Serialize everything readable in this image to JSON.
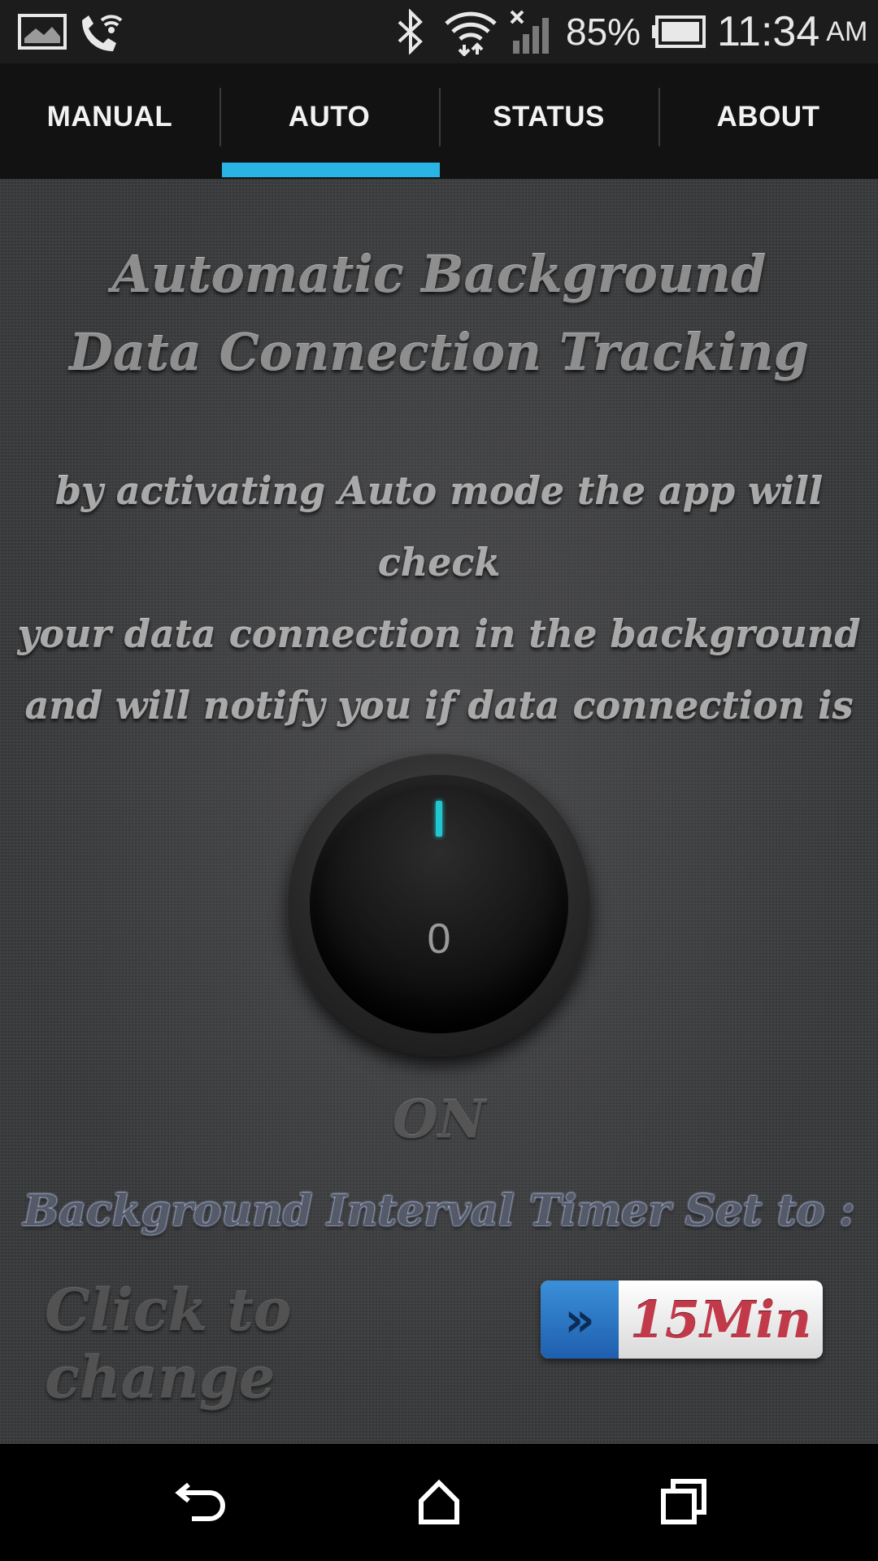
{
  "status_bar": {
    "battery_percent": "85%",
    "time": "11:34",
    "ampm": "AM",
    "icons": [
      "gallery-notification-icon",
      "wifi-calling-icon",
      "bluetooth-icon",
      "wifi-icon",
      "signal-icon",
      "battery-icon"
    ]
  },
  "tabs": [
    {
      "label": "MANUAL",
      "selected": false
    },
    {
      "label": "AUTO",
      "selected": true
    },
    {
      "label": "STATUS",
      "selected": false
    },
    {
      "label": "ABOUT",
      "selected": false
    }
  ],
  "colors": {
    "accent": "#2ab4e6",
    "knob_indicator": "#21c6d0",
    "timer_text": "#c23a4a"
  },
  "main": {
    "title_line1": "Automatic Background",
    "title_line2": "Data Connection Tracking",
    "desc_line1": "by activating Auto mode the app will check",
    "desc_line2": "your data connection in the background",
    "desc_line3": "and will notify you if data connection is lost.",
    "knob_on_mark": "I",
    "knob_off_mark": "0",
    "state_label": "ON",
    "interval_label": "Background Interval Timer Set to :",
    "click_to_change": "Click to change",
    "timer_value": "15Min"
  },
  "nav": {
    "icons": [
      "back-icon",
      "home-icon",
      "recent-apps-icon"
    ]
  }
}
